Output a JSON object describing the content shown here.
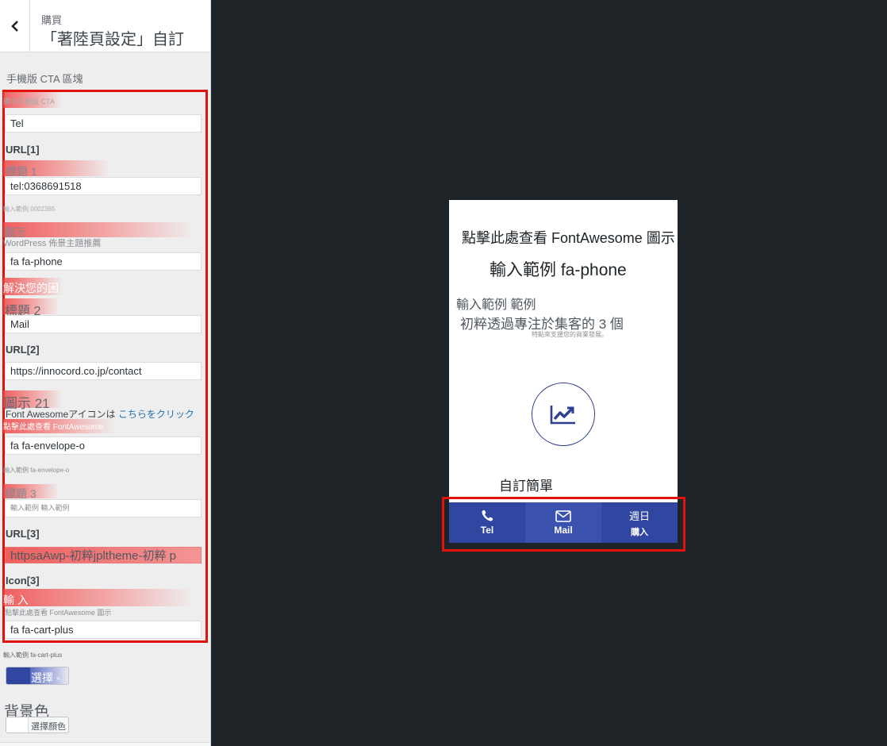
{
  "sidebar": {
    "back_icon": "chevron-left-icon",
    "header_small": "購買",
    "header_title": "「著陸頁設定」自訂",
    "section_title": "手機版 CTA 區塊",
    "field1_label": "顯示手機版 CTA",
    "field1_value": "Tel",
    "url1_label": "URL[1]",
    "title1_label": "標題 1",
    "title1_value": "tel:0368691518",
    "example_tel": "輸入範例 0002365",
    "icon1_label": "圖示",
    "icon1_desc": "WordPress 佈景主題推薦",
    "icon1_value": "fa fa-phone",
    "solve_text": "解決您的困",
    "title2_label": "標題 2",
    "title2_value": "Mail",
    "url2_label": "URL[2]",
    "url2_value": "https://innocord.co.jp/contact",
    "icon2_label": "圖示 21",
    "fa_note": "Font Awesomeアイコンは ",
    "fa_link": "こちらをクリック",
    "click_fa": "點擊此處查看 FontAwesome",
    "icon2_value": "fa fa-envelope-o",
    "example_envelope": "輸入範例 fa-envelope-o",
    "title3_label": "標題 3",
    "title3_placeholder": "輸入範例 輸入範例",
    "url3_label": "URL[3]",
    "url3_value": "httpsaAwp-初粹jpltheme-初粹 p",
    "icon3_label": "Icon[3]",
    "input_label": "輸 入",
    "click_fa_icons": "點擊此處查看 FontAwesome 圖示",
    "icon3_value": "fa fa-cart-plus",
    "example_cart": "輸入範例 fa-cart-plus",
    "select_label": "選擇 ◦",
    "bg_label": "背景色",
    "select_color": "選擇顏色 ◦",
    "accent_color": "#3046a0"
  },
  "preview": {
    "title": "點擊此處查看 FontAwesome 圖示",
    "subtitle": "輸入範例 fa-phone",
    "text1": "輸入範例 範例",
    "text2": "初粹透過專注於集客的 3 個",
    "text3": "特點來支援您的商業發展。",
    "chart_icon": "chart-line-icon",
    "text4": "自訂簡單",
    "cta_color": "#3046a0",
    "cta_tel_icon": "phone-icon",
    "cta_tel": "Tel",
    "cta_mail_icon": "envelope-icon",
    "cta_mail": "Mail",
    "cta_buy_top": "週日",
    "cta_buy": "購入"
  }
}
